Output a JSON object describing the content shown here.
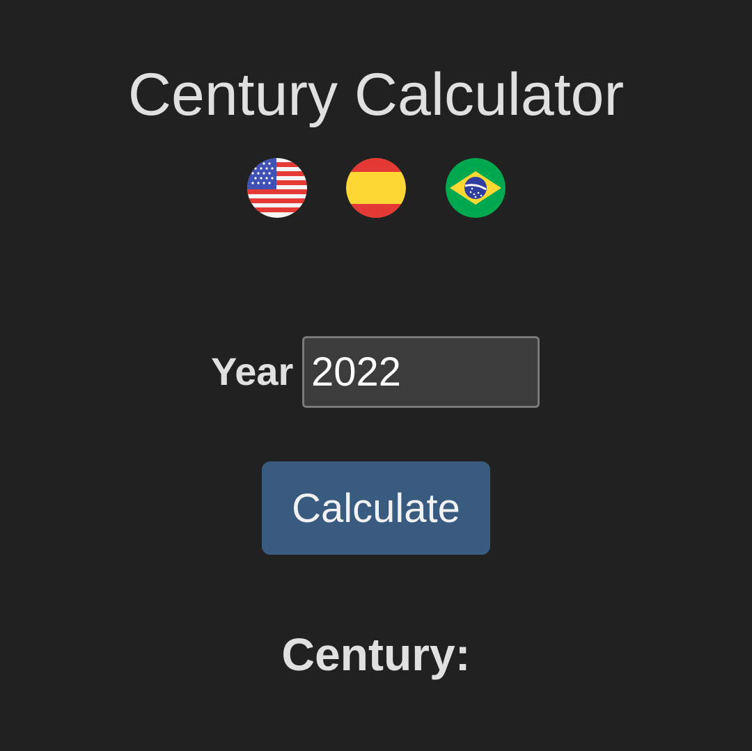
{
  "header": {
    "title": "Century Calculator"
  },
  "languages": [
    {
      "code": "en",
      "icon": "us-flag-icon"
    },
    {
      "code": "es",
      "icon": "spain-flag-icon"
    },
    {
      "code": "pt",
      "icon": "brazil-flag-icon"
    }
  ],
  "form": {
    "year_label": "Year",
    "year_value": "2022",
    "calculate_label": "Calculate"
  },
  "result": {
    "label": "Century:"
  },
  "colors": {
    "background": "#212121",
    "button": "#395b80",
    "input_background": "#3c3c3c"
  }
}
